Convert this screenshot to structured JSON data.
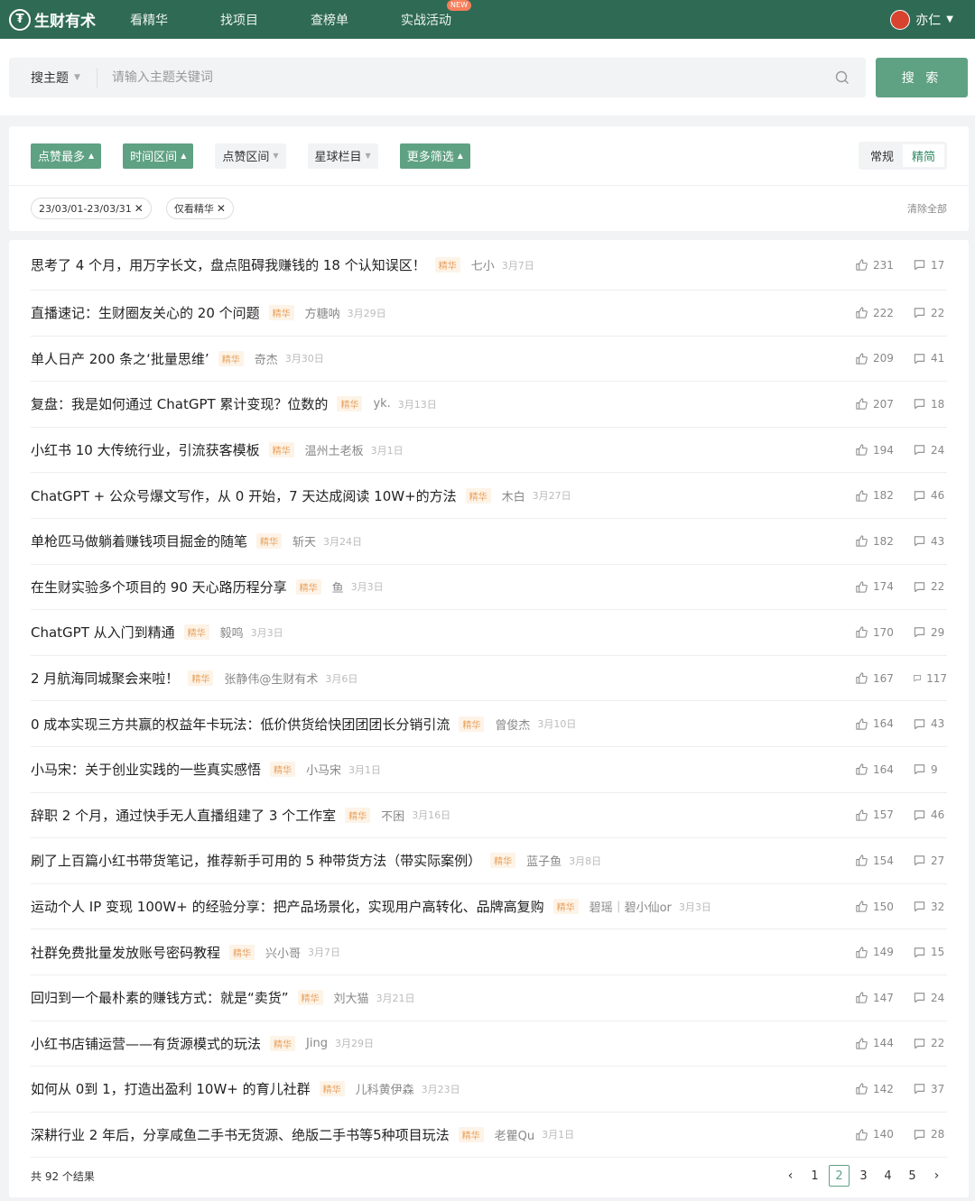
{
  "nav": {
    "logo_mark": "₮",
    "logo_text": "生财有术",
    "items": [
      {
        "label": "看精华"
      },
      {
        "label": "找项目"
      },
      {
        "label": "查榜单"
      },
      {
        "label": "实战活动",
        "badge": "NEW"
      }
    ],
    "user_name": "亦仁"
  },
  "search": {
    "type_label": "搜主题",
    "placeholder": "请输入主题关键词",
    "button_label": "搜 索"
  },
  "filters": {
    "buttons": [
      {
        "label": "点赞最多",
        "active": true
      },
      {
        "label": "时间区间",
        "active": true
      },
      {
        "label": "点赞区间",
        "active": false
      },
      {
        "label": "星球栏目",
        "active": false
      },
      {
        "label": "更多筛选",
        "active": true
      }
    ],
    "view_options": [
      "常规",
      "精简"
    ],
    "view_selected": "精简",
    "chips": [
      "23/03/01-23/03/31",
      "仅看精华"
    ],
    "clear_all": "清除全部"
  },
  "posts": [
    {
      "title": "思考了 4 个月，用万字长文，盘点阻碍我赚钱的 18 个认知误区！",
      "tag": "精华",
      "author": "七小",
      "date": "3月7日",
      "likes": "231",
      "comments": "17"
    },
    {
      "title": "直播速记：生财圈友关心的 20 个问题",
      "tag": "精华",
      "author": "方糖呐",
      "date": "3月29日",
      "likes": "222",
      "comments": "22"
    },
    {
      "title": "单人日产 200 条之‘批量思维’",
      "tag": "精华",
      "author": "奇杰",
      "date": "3月30日",
      "likes": "209",
      "comments": "41"
    },
    {
      "title": "复盘：我是如何通过 ChatGPT 累计变现？位数的",
      "tag": "精华",
      "author": "yk.",
      "date": "3月13日",
      "likes": "207",
      "comments": "18"
    },
    {
      "title": "小红书 10 大传统行业，引流获客模板",
      "tag": "精华",
      "author": "温州土老板",
      "date": "3月1日",
      "likes": "194",
      "comments": "24"
    },
    {
      "title": "ChatGPT + 公众号爆文写作，从 0 开始，7 天达成阅读 10W+的方法",
      "tag": "精华",
      "author": "木白",
      "date": "3月27日",
      "likes": "182",
      "comments": "46"
    },
    {
      "title": "单枪匹马做躺着赚钱项目掘金的随笔",
      "tag": "精华",
      "author": "斩天",
      "date": "3月24日",
      "likes": "182",
      "comments": "43"
    },
    {
      "title": "在生财实验多个项目的 90 天心路历程分享",
      "tag": "精华",
      "author": "鱼",
      "date": "3月3日",
      "likes": "174",
      "comments": "22"
    },
    {
      "title": "ChatGPT 从入门到精通",
      "tag": "精华",
      "author": "毅鸣",
      "date": "3月3日",
      "likes": "170",
      "comments": "29"
    },
    {
      "title": "2 月航海同城聚会来啦！",
      "tag": "精华",
      "author": "张静伟@生财有术",
      "date": "3月6日",
      "likes": "167",
      "comments": "117"
    },
    {
      "title": "0 成本实现三方共赢的权益年卡玩法：低价供货给快团团团长分销引流",
      "tag": "精华",
      "author": "曾俊杰",
      "date": "3月10日",
      "likes": "164",
      "comments": "43"
    },
    {
      "title": "小马宋：关于创业实践的一些真实感悟",
      "tag": "精华",
      "author": "小马宋",
      "date": "3月1日",
      "likes": "164",
      "comments": "9"
    },
    {
      "title": "辞职 2 个月，通过快手无人直播组建了 3 个工作室",
      "tag": "精华",
      "author": "不困",
      "date": "3月16日",
      "likes": "157",
      "comments": "46"
    },
    {
      "title": "刷了上百篇小红书带货笔记，推荐新手可用的 5 种带货方法（带实际案例）",
      "tag": "精华",
      "author": "蓝子鱼",
      "date": "3月8日",
      "likes": "154",
      "comments": "27"
    },
    {
      "title": "运动个人 IP 变现 100W+ 的经验分享：把产品场景化，实现用户高转化、品牌高复购",
      "tag": "精华",
      "author": "碧瑶｜碧小仙or",
      "date": "3月3日",
      "likes": "150",
      "comments": "32"
    },
    {
      "title": "社群免费批量发放账号密码教程",
      "tag": "精华",
      "author": "兴小哥",
      "date": "3月7日",
      "likes": "149",
      "comments": "15"
    },
    {
      "title": "回归到一个最朴素的赚钱方式：就是“卖货”",
      "tag": "精华",
      "author": "刘大猫",
      "date": "3月21日",
      "likes": "147",
      "comments": "24"
    },
    {
      "title": "小红书店铺运营——有货源模式的玩法",
      "tag": "精华",
      "author": "Jing",
      "date": "3月29日",
      "likes": "144",
      "comments": "22"
    },
    {
      "title": "如何从 0到 1，打造出盈利 10W+ 的育儿社群",
      "tag": "精华",
      "author": "儿科黄伊森",
      "date": "3月23日",
      "likes": "142",
      "comments": "37"
    },
    {
      "title": "深耕行业 2 年后，分享咸鱼二手书无货源、绝版二手书等5种项目玩法",
      "tag": "精华",
      "author": "老瞿Qu",
      "date": "3月1日",
      "likes": "140",
      "comments": "28"
    }
  ],
  "footer": {
    "total": "共 92 个结果",
    "pages": [
      "1",
      "2",
      "3",
      "4",
      "5"
    ],
    "current_page": "2",
    "prev_arrow": "‹",
    "next_arrow": "›"
  },
  "colors": {
    "topbar": "#2f6a55",
    "accent": "#5fa183",
    "tag_text": "#e8a05c",
    "tag_bg": "#fdf3e7"
  }
}
